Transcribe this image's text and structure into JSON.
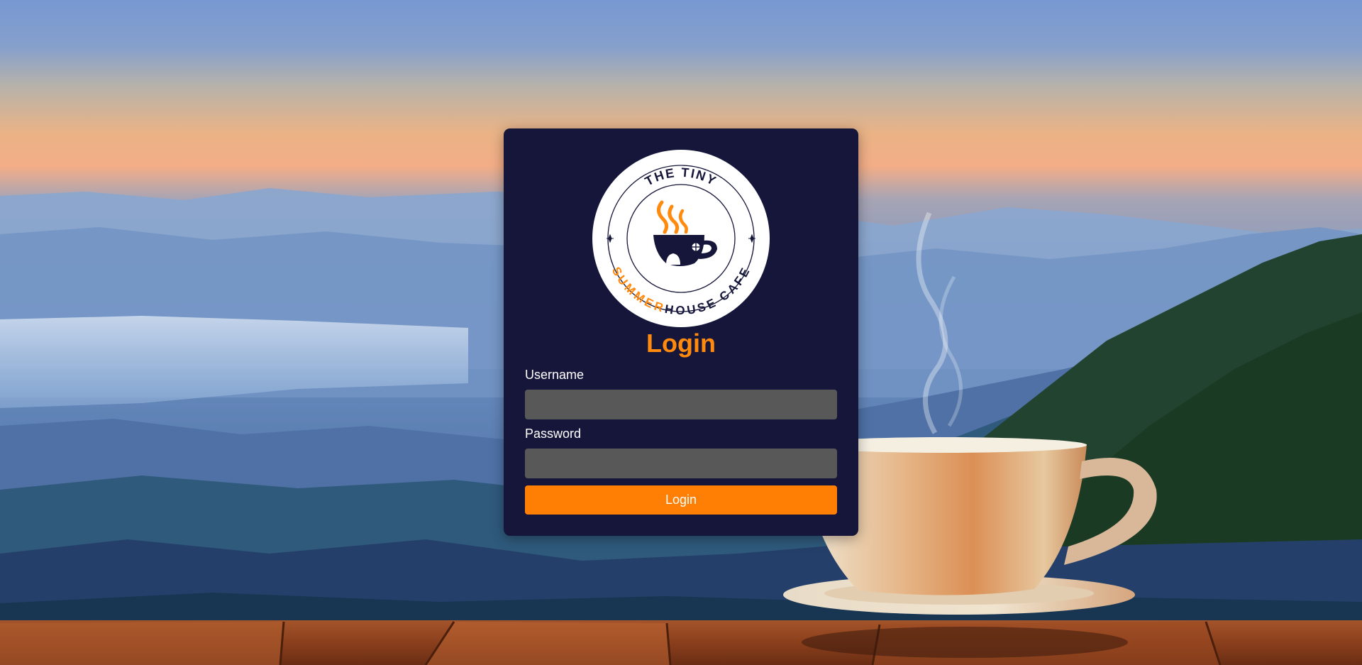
{
  "logo": {
    "top_text": "THE TINY",
    "bottom_text_accent": "SUMMER",
    "bottom_text_main": "HOUSE CAFE",
    "icon": "coffee-cup-house-icon"
  },
  "form": {
    "title": "Login",
    "username_label": "Username",
    "username_value": "",
    "password_label": "Password",
    "password_value": "",
    "submit_label": "Login"
  },
  "colors": {
    "card_background": "#15163a",
    "accent": "#ff8a0d",
    "button": "#ff7f04",
    "input_background": "#585858"
  }
}
